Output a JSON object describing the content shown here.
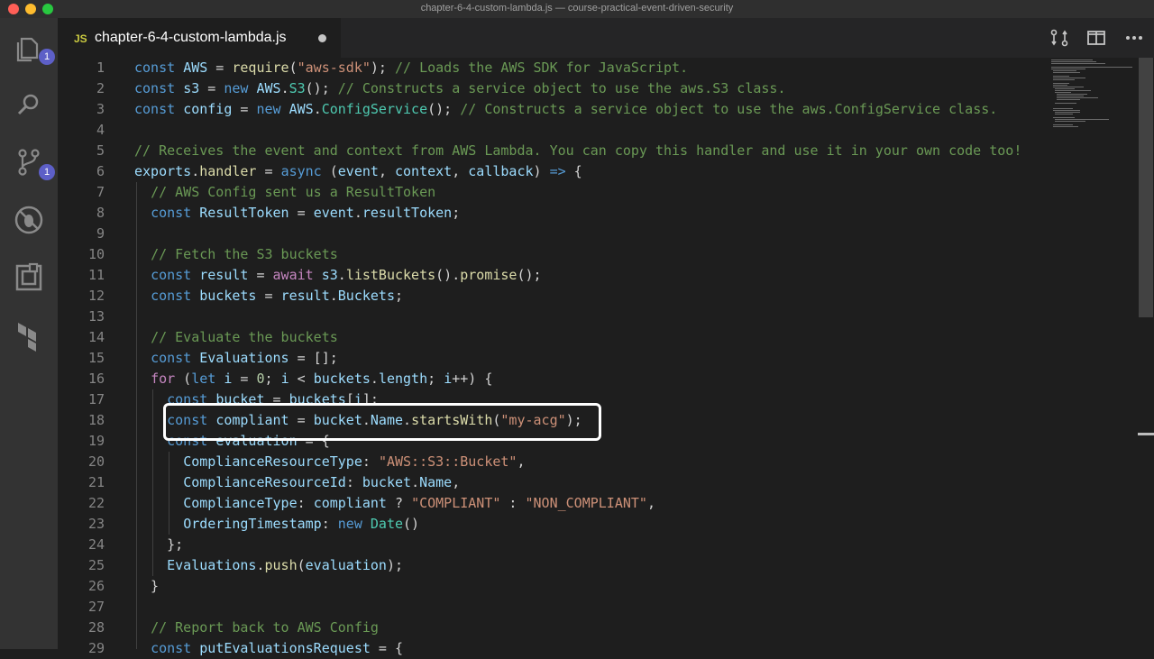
{
  "window": {
    "title": "chapter-6-4-custom-lambda.js — course-practical-event-driven-security"
  },
  "activity_bar": {
    "items": [
      {
        "icon": "files-icon",
        "badge": "1"
      },
      {
        "icon": "search-icon"
      },
      {
        "icon": "source-control-icon",
        "badge": "1"
      },
      {
        "icon": "debug-icon"
      },
      {
        "icon": "extensions-icon"
      },
      {
        "icon": "terraform-icon"
      }
    ]
  },
  "tab": {
    "lang_badge": "JS",
    "filename": "chapter-6-4-custom-lambda.js",
    "modified": true
  },
  "toolbar": {
    "icons": [
      "compare-changes-icon",
      "split-editor-icon",
      "more-actions-icon"
    ]
  },
  "colors": {
    "keyword": "#569cd6",
    "control": "#c586c0",
    "string": "#ce9178",
    "comment": "#6a9955",
    "variable": "#9cdcfe",
    "function": "#dcdcaa",
    "class": "#4ec9b0",
    "number": "#b5cea8",
    "plain": "#d4d4d4"
  },
  "code_lines": [
    {
      "n": "1",
      "tokens": [
        [
          "k",
          "const"
        ],
        [
          "p",
          " "
        ],
        [
          "v",
          "AWS"
        ],
        [
          "p",
          " = "
        ],
        [
          "f",
          "require"
        ],
        [
          "p",
          "("
        ],
        [
          "s",
          "\"aws-sdk\""
        ],
        [
          "p",
          "); "
        ],
        [
          "c",
          "// Loads the AWS SDK for JavaScript."
        ]
      ]
    },
    {
      "n": "2",
      "tokens": [
        [
          "k",
          "const"
        ],
        [
          "p",
          " "
        ],
        [
          "v",
          "s3"
        ],
        [
          "p",
          " = "
        ],
        [
          "k",
          "new"
        ],
        [
          "p",
          " "
        ],
        [
          "v",
          "AWS"
        ],
        [
          "p",
          "."
        ],
        [
          "t",
          "S3"
        ],
        [
          "p",
          "(); "
        ],
        [
          "c",
          "// Constructs a service object to use the aws.S3 class."
        ]
      ]
    },
    {
      "n": "3",
      "tokens": [
        [
          "k",
          "const"
        ],
        [
          "p",
          " "
        ],
        [
          "v",
          "config"
        ],
        [
          "p",
          " = "
        ],
        [
          "k",
          "new"
        ],
        [
          "p",
          " "
        ],
        [
          "v",
          "AWS"
        ],
        [
          "p",
          "."
        ],
        [
          "t",
          "ConfigService"
        ],
        [
          "p",
          "(); "
        ],
        [
          "c",
          "// Constructs a service object to use the aws.ConfigService class."
        ]
      ]
    },
    {
      "n": "4",
      "tokens": []
    },
    {
      "n": "5",
      "tokens": [
        [
          "c",
          "// Receives the event and context from AWS Lambda. You can copy this handler and use it in your own code too!"
        ]
      ]
    },
    {
      "n": "6",
      "tokens": [
        [
          "v",
          "exports"
        ],
        [
          "p",
          "."
        ],
        [
          "f",
          "handler"
        ],
        [
          "p",
          " = "
        ],
        [
          "k",
          "async"
        ],
        [
          "p",
          " ("
        ],
        [
          "v",
          "event"
        ],
        [
          "p",
          ", "
        ],
        [
          "v",
          "context"
        ],
        [
          "p",
          ", "
        ],
        [
          "v",
          "callback"
        ],
        [
          "p",
          ") "
        ],
        [
          "k",
          "=>"
        ],
        [
          "p",
          " {"
        ]
      ]
    },
    {
      "n": "7",
      "tokens": [
        [
          "p",
          "  "
        ],
        [
          "c",
          "// AWS Config sent us a ResultToken"
        ]
      ]
    },
    {
      "n": "8",
      "tokens": [
        [
          "p",
          "  "
        ],
        [
          "k",
          "const"
        ],
        [
          "p",
          " "
        ],
        [
          "v",
          "ResultToken"
        ],
        [
          "p",
          " = "
        ],
        [
          "v",
          "event"
        ],
        [
          "p",
          "."
        ],
        [
          "v",
          "resultToken"
        ],
        [
          "p",
          ";"
        ]
      ]
    },
    {
      "n": "9",
      "tokens": []
    },
    {
      "n": "10",
      "tokens": [
        [
          "p",
          "  "
        ],
        [
          "c",
          "// Fetch the S3 buckets"
        ]
      ]
    },
    {
      "n": "11",
      "tokens": [
        [
          "p",
          "  "
        ],
        [
          "k",
          "const"
        ],
        [
          "p",
          " "
        ],
        [
          "v",
          "result"
        ],
        [
          "p",
          " = "
        ],
        [
          "x",
          "await"
        ],
        [
          "p",
          " "
        ],
        [
          "v",
          "s3"
        ],
        [
          "p",
          "."
        ],
        [
          "f",
          "listBuckets"
        ],
        [
          "p",
          "()."
        ],
        [
          "f",
          "promise"
        ],
        [
          "p",
          "();"
        ]
      ]
    },
    {
      "n": "12",
      "tokens": [
        [
          "p",
          "  "
        ],
        [
          "k",
          "const"
        ],
        [
          "p",
          " "
        ],
        [
          "v",
          "buckets"
        ],
        [
          "p",
          " = "
        ],
        [
          "v",
          "result"
        ],
        [
          "p",
          "."
        ],
        [
          "v",
          "Buckets"
        ],
        [
          "p",
          ";"
        ]
      ]
    },
    {
      "n": "13",
      "tokens": []
    },
    {
      "n": "14",
      "tokens": [
        [
          "p",
          "  "
        ],
        [
          "c",
          "// Evaluate the buckets"
        ]
      ]
    },
    {
      "n": "15",
      "tokens": [
        [
          "p",
          "  "
        ],
        [
          "k",
          "const"
        ],
        [
          "p",
          " "
        ],
        [
          "v",
          "Evaluations"
        ],
        [
          "p",
          " = [];"
        ]
      ]
    },
    {
      "n": "16",
      "tokens": [
        [
          "p",
          "  "
        ],
        [
          "x",
          "for"
        ],
        [
          "p",
          " ("
        ],
        [
          "k",
          "let"
        ],
        [
          "p",
          " "
        ],
        [
          "v",
          "i"
        ],
        [
          "p",
          " = "
        ],
        [
          "n",
          "0"
        ],
        [
          "p",
          "; "
        ],
        [
          "v",
          "i"
        ],
        [
          "p",
          " < "
        ],
        [
          "v",
          "buckets"
        ],
        [
          "p",
          "."
        ],
        [
          "v",
          "length"
        ],
        [
          "p",
          "; "
        ],
        [
          "v",
          "i"
        ],
        [
          "p",
          "++) {"
        ]
      ]
    },
    {
      "n": "17",
      "tokens": [
        [
          "p",
          "    "
        ],
        [
          "k",
          "const"
        ],
        [
          "p",
          " "
        ],
        [
          "v",
          "bucket"
        ],
        [
          "p",
          " = "
        ],
        [
          "v",
          "buckets"
        ],
        [
          "p",
          "["
        ],
        [
          "v",
          "i"
        ],
        [
          "p",
          "];"
        ]
      ]
    },
    {
      "n": "18",
      "tokens": [
        [
          "p",
          "    "
        ],
        [
          "k",
          "const"
        ],
        [
          "p",
          " "
        ],
        [
          "v",
          "compliant"
        ],
        [
          "p",
          " = "
        ],
        [
          "v",
          "bucket"
        ],
        [
          "p",
          "."
        ],
        [
          "v",
          "Name"
        ],
        [
          "p",
          "."
        ],
        [
          "f",
          "startsWith"
        ],
        [
          "p",
          "("
        ],
        [
          "s",
          "\"my-acg\""
        ],
        [
          "p",
          ");"
        ]
      ]
    },
    {
      "n": "19",
      "tokens": [
        [
          "p",
          "    "
        ],
        [
          "k",
          "const"
        ],
        [
          "p",
          " "
        ],
        [
          "v",
          "evaluation"
        ],
        [
          "p",
          " = {"
        ]
      ]
    },
    {
      "n": "20",
      "tokens": [
        [
          "p",
          "      "
        ],
        [
          "v",
          "ComplianceResourceType"
        ],
        [
          "p",
          ": "
        ],
        [
          "s",
          "\"AWS::S3::Bucket\""
        ],
        [
          "p",
          ","
        ]
      ]
    },
    {
      "n": "21",
      "tokens": [
        [
          "p",
          "      "
        ],
        [
          "v",
          "ComplianceResourceId"
        ],
        [
          "p",
          ": "
        ],
        [
          "v",
          "bucket"
        ],
        [
          "p",
          "."
        ],
        [
          "v",
          "Name"
        ],
        [
          "p",
          ","
        ]
      ]
    },
    {
      "n": "22",
      "tokens": [
        [
          "p",
          "      "
        ],
        [
          "v",
          "ComplianceType"
        ],
        [
          "p",
          ": "
        ],
        [
          "v",
          "compliant"
        ],
        [
          "p",
          " ? "
        ],
        [
          "s",
          "\"COMPLIANT\""
        ],
        [
          "p",
          " : "
        ],
        [
          "s",
          "\"NON_COMPLIANT\""
        ],
        [
          "p",
          ","
        ]
      ]
    },
    {
      "n": "23",
      "tokens": [
        [
          "p",
          "      "
        ],
        [
          "v",
          "OrderingTimestamp"
        ],
        [
          "p",
          ": "
        ],
        [
          "k",
          "new"
        ],
        [
          "p",
          " "
        ],
        [
          "t",
          "Date"
        ],
        [
          "p",
          "()"
        ]
      ]
    },
    {
      "n": "24",
      "tokens": [
        [
          "p",
          "    };"
        ]
      ]
    },
    {
      "n": "25",
      "tokens": [
        [
          "p",
          "    "
        ],
        [
          "v",
          "Evaluations"
        ],
        [
          "p",
          "."
        ],
        [
          "f",
          "push"
        ],
        [
          "p",
          "("
        ],
        [
          "v",
          "evaluation"
        ],
        [
          "p",
          ");"
        ]
      ]
    },
    {
      "n": "26",
      "tokens": [
        [
          "p",
          "  }"
        ]
      ]
    },
    {
      "n": "27",
      "tokens": []
    },
    {
      "n": "28",
      "tokens": [
        [
          "p",
          "  "
        ],
        [
          "c",
          "// Report back to AWS Config"
        ]
      ]
    },
    {
      "n": "29",
      "tokens": [
        [
          "p",
          "  "
        ],
        [
          "k",
          "const"
        ],
        [
          "p",
          " "
        ],
        [
          "v",
          "putEvaluationsRequest"
        ],
        [
          "p",
          " = {"
        ]
      ]
    }
  ]
}
